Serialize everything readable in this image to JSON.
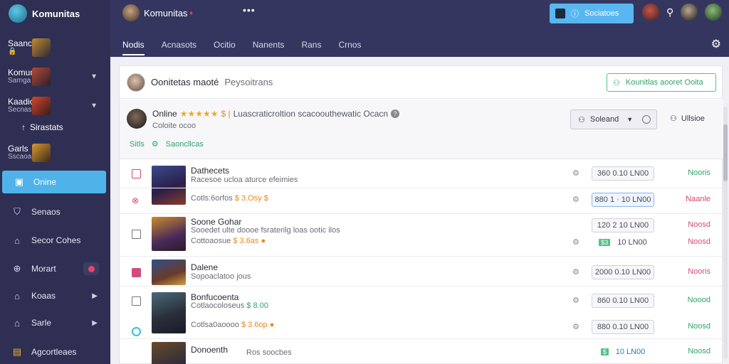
{
  "sidebar": {
    "brand": "Komunitas",
    "group1": {
      "title": "Saance",
      "sub": "🔒"
    },
    "group2": {
      "title": "Komunitay",
      "sub": "Sarnga"
    },
    "group3": {
      "title": "Kaadios",
      "sub": "Secnas"
    },
    "sub_item": "Sirastats",
    "group4": {
      "title": "Garls",
      "sub": "Sscaoas"
    },
    "items": [
      {
        "label": "Onine",
        "icon": "chart-icon"
      },
      {
        "label": "Senaos",
        "icon": "shield-icon"
      },
      {
        "label": "Secor Cohes",
        "icon": "home-icon"
      },
      {
        "label": "Morart",
        "icon": "plus-icon"
      },
      {
        "label": "Koaas",
        "icon": "home-icon"
      },
      {
        "label": "Sarle",
        "icon": "home-icon"
      },
      {
        "label": "Agcortleaes",
        "icon": "folder-icon"
      }
    ]
  },
  "topbar": {
    "title": "Komunitas",
    "cta_label": "Sociatoes",
    "tabs": [
      "Nodis",
      "Acnasots",
      "Ocitio",
      "Nanents",
      "Rans",
      "Crnos"
    ]
  },
  "panel": {
    "header_title": "Oonitetas maoté",
    "header_sub": "Peysoitrans",
    "header_button": "Kounitlas aooret Ooita",
    "info": {
      "status": "Online",
      "stars": "★★★★★",
      "rating_count": "$ |",
      "description": "Luascraticroltion scacoouthewatic Ocacn",
      "sub": "Coloite ocoo",
      "tag1": "Sitls",
      "tag2": "Saoncllcas",
      "select_label": "Soleand",
      "user_label": "Ullsioe"
    },
    "rows": [
      {
        "name": "Dathecets",
        "sub": "Racesoe ucloa aturce efeimies",
        "sub_hl": "",
        "value": "360 0.10  LN00",
        "pill": "plain",
        "status": "Nooris",
        "status_color": "green",
        "check": "red"
      },
      {
        "name": "",
        "sub": "Cotls:6orfos",
        "sub_hl": "$ 3.Osy $",
        "value": "880 1 · 10  LN00",
        "pill": "blue",
        "status": "Naanle",
        "status_color": "red",
        "check": "redmark"
      },
      {
        "name": "Soone Gohar",
        "sub": "Sooedet ulte doooe fsraterilg loas ootic ilos",
        "sub_hl": "",
        "value": "120 2 10  LN00",
        "pill": "plain",
        "status": "Noosd",
        "status_color": "pink",
        "check": "grey"
      },
      {
        "name": "",
        "sub": "Cottoaosue",
        "sub_hl": "$ 3.6as ●",
        "value": "10  LN00",
        "pill": "green",
        "status": "Noosd",
        "status_color": "pink",
        "check": ""
      },
      {
        "name": "Dalene",
        "sub": "Sopoaclatoo jous",
        "sub_hl": "",
        "value": "2000 0.10  LN00",
        "pill": "plain",
        "status": "Nooris",
        "status_color": "pink",
        "check": "pink"
      },
      {
        "name": "Bonfucoenta",
        "sub": "Cotlaocoloseus",
        "sub_hl": "$ 8.00",
        "value": "860 0.10  LN00",
        "pill": "plain",
        "status": "Noood",
        "status_color": "green",
        "check": "grey"
      },
      {
        "name": "",
        "sub": "Cotlsa0aoooo",
        "sub_hl": "$ 3.6op ●",
        "value": "880 0.10  LN00",
        "pill": "plain",
        "status": "Noosd",
        "status_color": "green",
        "check": "teal"
      },
      {
        "name": "Donoenth",
        "sub": "Ros soocbes",
        "sub_hl": "",
        "value": "10  LN00",
        "pill": "green-nob",
        "status": "Noosd",
        "status_color": "green",
        "check": ""
      }
    ]
  },
  "colors": {
    "accent": "#4fb3ea",
    "sidebar": "#2e2f52",
    "topbar": "#353660",
    "green": "#2fa46c",
    "red": "#d8475f"
  }
}
